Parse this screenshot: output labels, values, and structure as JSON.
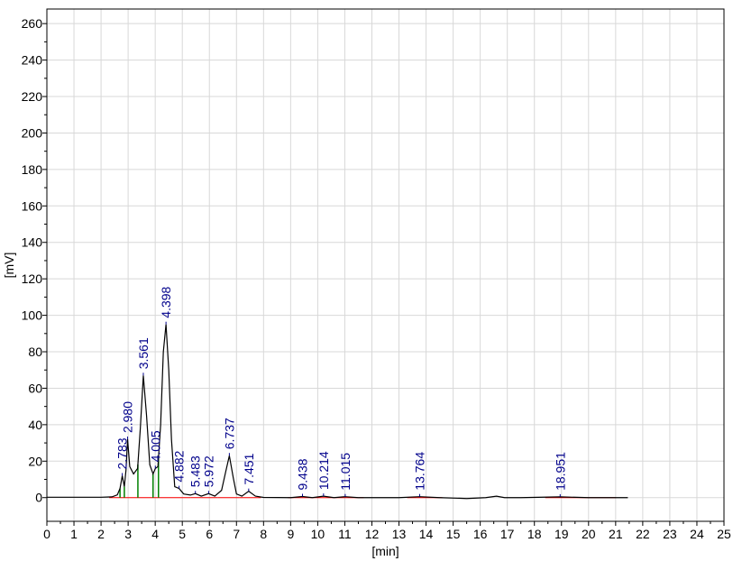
{
  "chart_data": {
    "type": "line",
    "xlabel": "[min]",
    "ylabel": "[mV]",
    "xlim": [
      0,
      25
    ],
    "ylim": [
      -13,
      268
    ],
    "x_ticks": [
      0,
      1,
      2,
      3,
      4,
      5,
      6,
      7,
      8,
      9,
      10,
      11,
      12,
      13,
      14,
      15,
      16,
      17,
      18,
      19,
      20,
      21,
      22,
      23,
      24,
      25
    ],
    "y_ticks": [
      0,
      20,
      40,
      60,
      80,
      100,
      120,
      140,
      160,
      180,
      200,
      220,
      240,
      260
    ],
    "grid": true,
    "colors": {
      "trace": "#000000",
      "peak_label": "#00008b",
      "baseline": "#ff0000",
      "peak_marker": "#008000",
      "grid": "#d8d8d8"
    },
    "series": [
      {
        "points": [
          [
            0,
            0.2
          ],
          [
            1,
            0.2
          ],
          [
            2.0,
            0.2
          ],
          [
            2.4,
            0.4
          ],
          [
            2.6,
            1.5
          ],
          [
            2.7,
            5
          ],
          [
            2.783,
            12
          ],
          [
            2.86,
            6
          ],
          [
            2.92,
            15
          ],
          [
            2.98,
            32
          ],
          [
            3.06,
            17
          ],
          [
            3.2,
            13
          ],
          [
            3.35,
            16
          ],
          [
            3.45,
            38
          ],
          [
            3.561,
            67
          ],
          [
            3.68,
            45
          ],
          [
            3.8,
            18
          ],
          [
            3.92,
            13
          ],
          [
            4.005,
            16
          ],
          [
            4.1,
            17
          ],
          [
            4.2,
            40
          ],
          [
            4.3,
            80
          ],
          [
            4.398,
            95
          ],
          [
            4.5,
            70
          ],
          [
            4.6,
            32
          ],
          [
            4.72,
            6
          ],
          [
            4.882,
            5
          ],
          [
            5.05,
            2
          ],
          [
            5.3,
            1.4
          ],
          [
            5.483,
            2.2
          ],
          [
            5.7,
            0.8
          ],
          [
            5.972,
            2.2
          ],
          [
            6.2,
            0.8
          ],
          [
            6.45,
            4
          ],
          [
            6.6,
            14
          ],
          [
            6.737,
            23
          ],
          [
            6.88,
            11
          ],
          [
            7.0,
            2
          ],
          [
            7.2,
            0.8
          ],
          [
            7.451,
            3.5
          ],
          [
            7.7,
            0.8
          ],
          [
            8.0,
            0.1
          ],
          [
            9.0,
            0
          ],
          [
            9.438,
            0.6
          ],
          [
            9.8,
            0
          ],
          [
            10.214,
            0.8
          ],
          [
            10.6,
            0
          ],
          [
            11.015,
            0.5
          ],
          [
            11.5,
            0
          ],
          [
            13.0,
            0
          ],
          [
            13.764,
            0.5
          ],
          [
            14.5,
            0
          ],
          [
            15.5,
            -0.5
          ],
          [
            16.2,
            0
          ],
          [
            16.6,
            0.8
          ],
          [
            16.9,
            0
          ],
          [
            17.5,
            0
          ],
          [
            18.951,
            0.4
          ],
          [
            20.0,
            0
          ],
          [
            21.45,
            0
          ]
        ]
      }
    ],
    "peaks": [
      {
        "label": "2.783",
        "x": 2.783,
        "y": 12
      },
      {
        "label": "2.980",
        "x": 2.98,
        "y": 32
      },
      {
        "label": "3.561",
        "x": 3.561,
        "y": 67
      },
      {
        "label": "4.005",
        "x": 4.005,
        "y": 16
      },
      {
        "label": "4.398",
        "x": 4.398,
        "y": 95
      },
      {
        "label": "4.882",
        "x": 4.882,
        "y": 5
      },
      {
        "label": "5.483",
        "x": 5.483,
        "y": 2.2
      },
      {
        "label": "5.972",
        "x": 5.972,
        "y": 2.2
      },
      {
        "label": "6.737",
        "x": 6.737,
        "y": 23
      },
      {
        "label": "7.451",
        "x": 7.451,
        "y": 3.5
      },
      {
        "label": "9.438",
        "x": 9.438,
        "y": 0.6
      },
      {
        "label": "10.214",
        "x": 10.214,
        "y": 0.8
      },
      {
        "label": "11.015",
        "x": 11.015,
        "y": 0.5
      },
      {
        "label": "13.764",
        "x": 13.764,
        "y": 0.5
      },
      {
        "label": "18.951",
        "x": 18.951,
        "y": 0.4
      }
    ],
    "integration_boundaries": [
      2.7,
      2.86,
      3.36,
      3.92,
      4.12
    ],
    "baseline_segments": [
      [
        2.3,
        2.7
      ],
      [
        2.7,
        5.3
      ],
      [
        5.3,
        5.7
      ],
      [
        5.7,
        6.3
      ],
      [
        6.3,
        7.1
      ],
      [
        7.1,
        7.9
      ],
      [
        8.9,
        9.8
      ],
      [
        9.8,
        10.6
      ],
      [
        10.6,
        11.7
      ],
      [
        13.3,
        14.6
      ],
      [
        18.4,
        21.0
      ]
    ]
  }
}
